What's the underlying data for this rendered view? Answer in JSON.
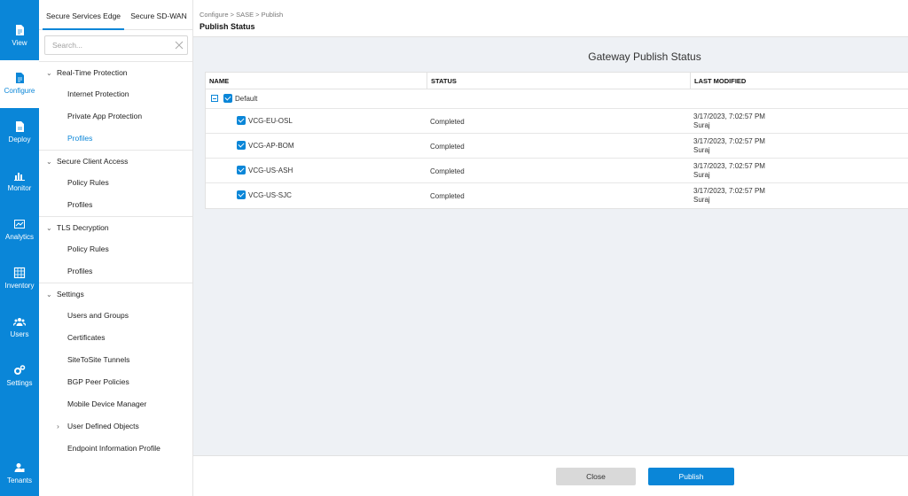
{
  "rail": [
    {
      "label": "View",
      "icon": "document-icon"
    },
    {
      "label": "Configure",
      "icon": "configure-doc-icon"
    },
    {
      "label": "Deploy",
      "icon": "deploy-doc-icon"
    },
    {
      "label": "Monitor",
      "icon": "bar-chart-icon"
    },
    {
      "label": "Analytics",
      "icon": "analytics-icon"
    },
    {
      "label": "Inventory",
      "icon": "inventory-icon"
    },
    {
      "label": "Users",
      "icon": "users-icon"
    },
    {
      "label": "Settings",
      "icon": "gears-icon"
    },
    {
      "label": "Tenants",
      "icon": "tenant-icon"
    }
  ],
  "sidebar": {
    "tabs": [
      "Secure Services Edge",
      "Secure SD-WAN"
    ],
    "search_placeholder": "Search...",
    "groups": [
      {
        "label": "Real-Time Protection",
        "items": [
          "Internet Protection",
          "Private App Protection",
          "Profiles"
        ]
      },
      {
        "label": "Secure Client Access",
        "items": [
          "Policy Rules",
          "Profiles"
        ]
      },
      {
        "label": "TLS Decryption",
        "items": [
          "Policy Rules",
          "Profiles"
        ]
      },
      {
        "label": "Settings",
        "items": [
          "Users and Groups",
          "Certificates",
          "SiteToSite Tunnels",
          "BGP Peer Policies",
          "Mobile Device Manager",
          "User Defined Objects",
          "Endpoint Information Profile"
        ]
      }
    ]
  },
  "header": {
    "breadcrumb": "Configure > SASE > Publish",
    "title": "Publish Status"
  },
  "panel": {
    "title": "Gateway Publish Status",
    "columns": [
      "NAME",
      "STATUS",
      "LAST MODIFIED"
    ],
    "group_label": "Default",
    "rows": [
      {
        "name": "VCG-EU-OSL",
        "status": "Completed",
        "modified": "3/17/2023, 7:02:57 PM",
        "user": "Suraj"
      },
      {
        "name": "VCG-AP-BOM",
        "status": "Completed",
        "modified": "3/17/2023, 7:02:57 PM",
        "user": "Suraj"
      },
      {
        "name": "VCG-US-ASH",
        "status": "Completed",
        "modified": "3/17/2023, 7:02:57 PM",
        "user": "Suraj"
      },
      {
        "name": "VCG-US-SJC",
        "status": "Completed",
        "modified": "3/17/2023, 7:02:57 PM",
        "user": "Suraj"
      }
    ]
  },
  "footer": {
    "close_label": "Close",
    "publish_label": "Publish"
  },
  "colors": {
    "accent": "#0a86d8",
    "background": "#eef1f5"
  }
}
